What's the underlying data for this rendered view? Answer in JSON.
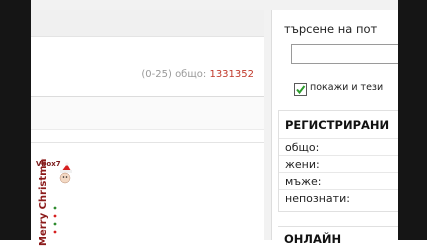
{
  "listing": {
    "range": "(0-25)",
    "total_label": "общо:",
    "total_value": "1331352"
  },
  "avatar": {
    "username_text": "Vbox7",
    "greeting": "Merry Christmas"
  },
  "sidebar": {
    "search": {
      "title": "търсене на пот",
      "input_value": "",
      "checkbox_label": "покажи и тези",
      "checkbox_checked": true
    },
    "registered": {
      "title": "РЕГИСТРИРАНИ",
      "rows": [
        {
          "label": "общо:"
        },
        {
          "label": "жени:"
        },
        {
          "label": "мъже:"
        },
        {
          "label": "непознати:"
        }
      ]
    },
    "online_title": "ОНЛАЙН"
  },
  "colors": {
    "total_value": "#c0392b",
    "checkmark": "#2e9d2e",
    "greeting": "#8b1a1a"
  }
}
